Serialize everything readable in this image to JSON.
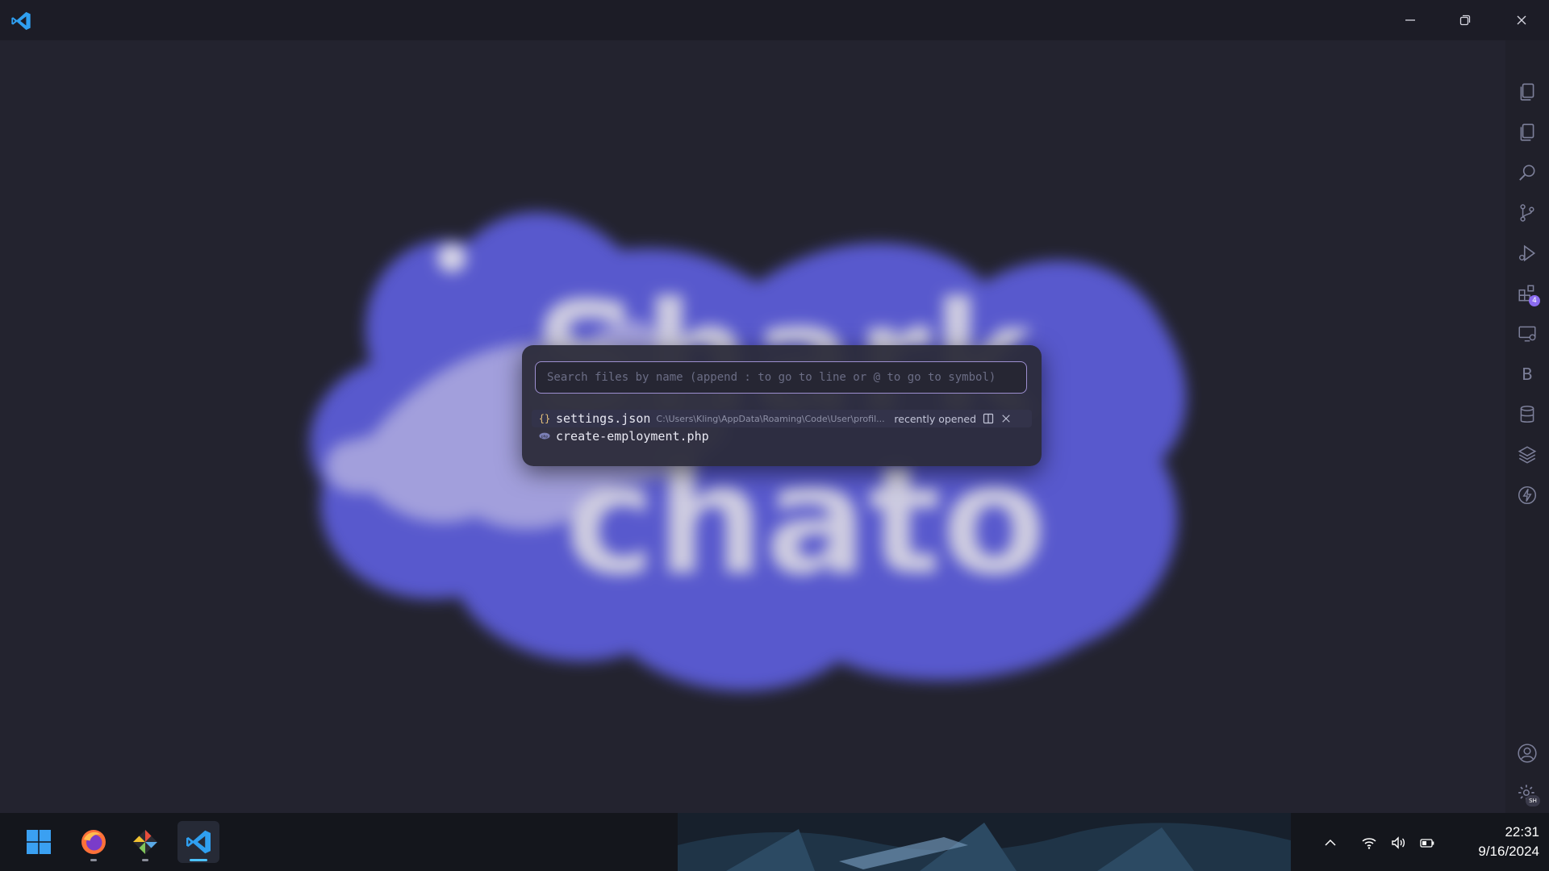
{
  "titlebar": {
    "app_icon": "vscode-icon",
    "controls": [
      "minimize-icon",
      "restore-icon",
      "close-icon"
    ]
  },
  "watermark": {
    "text_line1": "Shark",
    "text_line2": "chato",
    "colors": {
      "outline": "#5b5cd6",
      "fill": "#a9a6e6",
      "letters": "#d7d5ea"
    }
  },
  "quick_open": {
    "placeholder": "Search files by name (append : to go to line or @ to go to symbol)",
    "results": [
      {
        "icon": "json-braces-icon",
        "icon_text": "{}",
        "name": "settings.json",
        "path": "C:\\Users\\Kling\\AppData\\Roaming\\Code\\User\\profil...",
        "tag": "recently opened"
      },
      {
        "icon": "php-icon",
        "icon_text": "",
        "name": "create-employment.php"
      }
    ]
  },
  "activity_bar": {
    "items": [
      "explorer-icon",
      "copy-icon",
      "search-icon",
      "source-control-icon",
      "run-debug-icon",
      "extensions-icon",
      "remote-explorer-icon",
      "b-icon",
      "database-icon",
      "layers-icon",
      "lightning-icon"
    ],
    "b_label": "B",
    "extensions_badge": "4",
    "bottom": [
      "account-icon",
      "settings-gear-icon"
    ],
    "settings_badge": "SH"
  },
  "taskbar": {
    "apps": [
      "windows-start-icon",
      "firefox-icon",
      "git-icon",
      "vscode-icon"
    ],
    "tray": [
      "chevron-up-icon",
      "wifi-icon",
      "volume-icon",
      "battery-icon"
    ],
    "time": "22:31",
    "date": "9/16/2024"
  },
  "colors": {
    "accent": "#9d8fd0",
    "vscode_blue": "#2f9ff0",
    "taskbar_active": "#4cc2ff"
  }
}
